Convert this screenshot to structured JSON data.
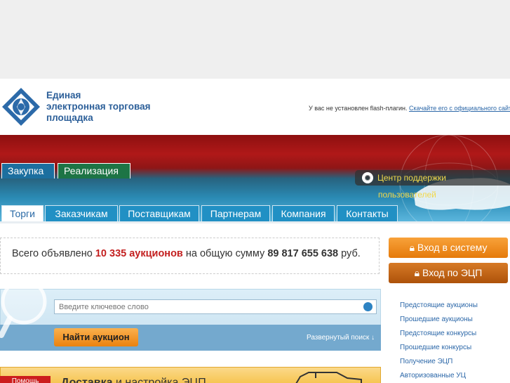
{
  "header": {
    "logo_line1": "Единая",
    "logo_line2": "электронная торговая",
    "logo_line3": "площадка",
    "flash_text": "У вас не установлен flash-плагин.",
    "flash_link": "Скачайте его с официального сайта"
  },
  "top_tabs": [
    {
      "label": "Закупка"
    },
    {
      "label": "Реализация"
    }
  ],
  "support": {
    "label_line1": "Центр поддержки",
    "label_line2": "пользователей"
  },
  "nav": [
    {
      "label": "Торги"
    },
    {
      "label": "Заказчикам"
    },
    {
      "label": "Поставщикам"
    },
    {
      "label": "Партнерам"
    },
    {
      "label": "Компания"
    },
    {
      "label": "Контакты"
    }
  ],
  "stats": {
    "prefix": "Всего объявлено",
    "auctions": "10 335 аукционов",
    "middle": "на общую сумму",
    "amount": "89 817 655 638",
    "suffix": "руб."
  },
  "buttons": {
    "login": "Вход в систему",
    "ecp_login": "Вход по ЭЦП"
  },
  "search": {
    "placeholder": "Введите ключевое слово",
    "find_label": "Найти аукцион",
    "advanced_label": "Развернутый поиск ↓"
  },
  "side_links": [
    {
      "label": "Предстоящие аукционы"
    },
    {
      "label": "Прошедшие аукционы"
    },
    {
      "label": "Предстоящие конкурсы"
    },
    {
      "label": "Прошедшие конкурсы"
    },
    {
      "label": "Получение ЭЦП"
    },
    {
      "label": "Авторизованные УЦ"
    }
  ],
  "promo": {
    "help_badge": "Помощь",
    "title_bold": "Доставка",
    "title_rest": "и настройка ЭЦП"
  },
  "colors": {
    "brand_blue": "#2c5f99",
    "accent_orange": "#f08c1e",
    "banner_red": "#a01515",
    "link": "#2b67a8"
  }
}
